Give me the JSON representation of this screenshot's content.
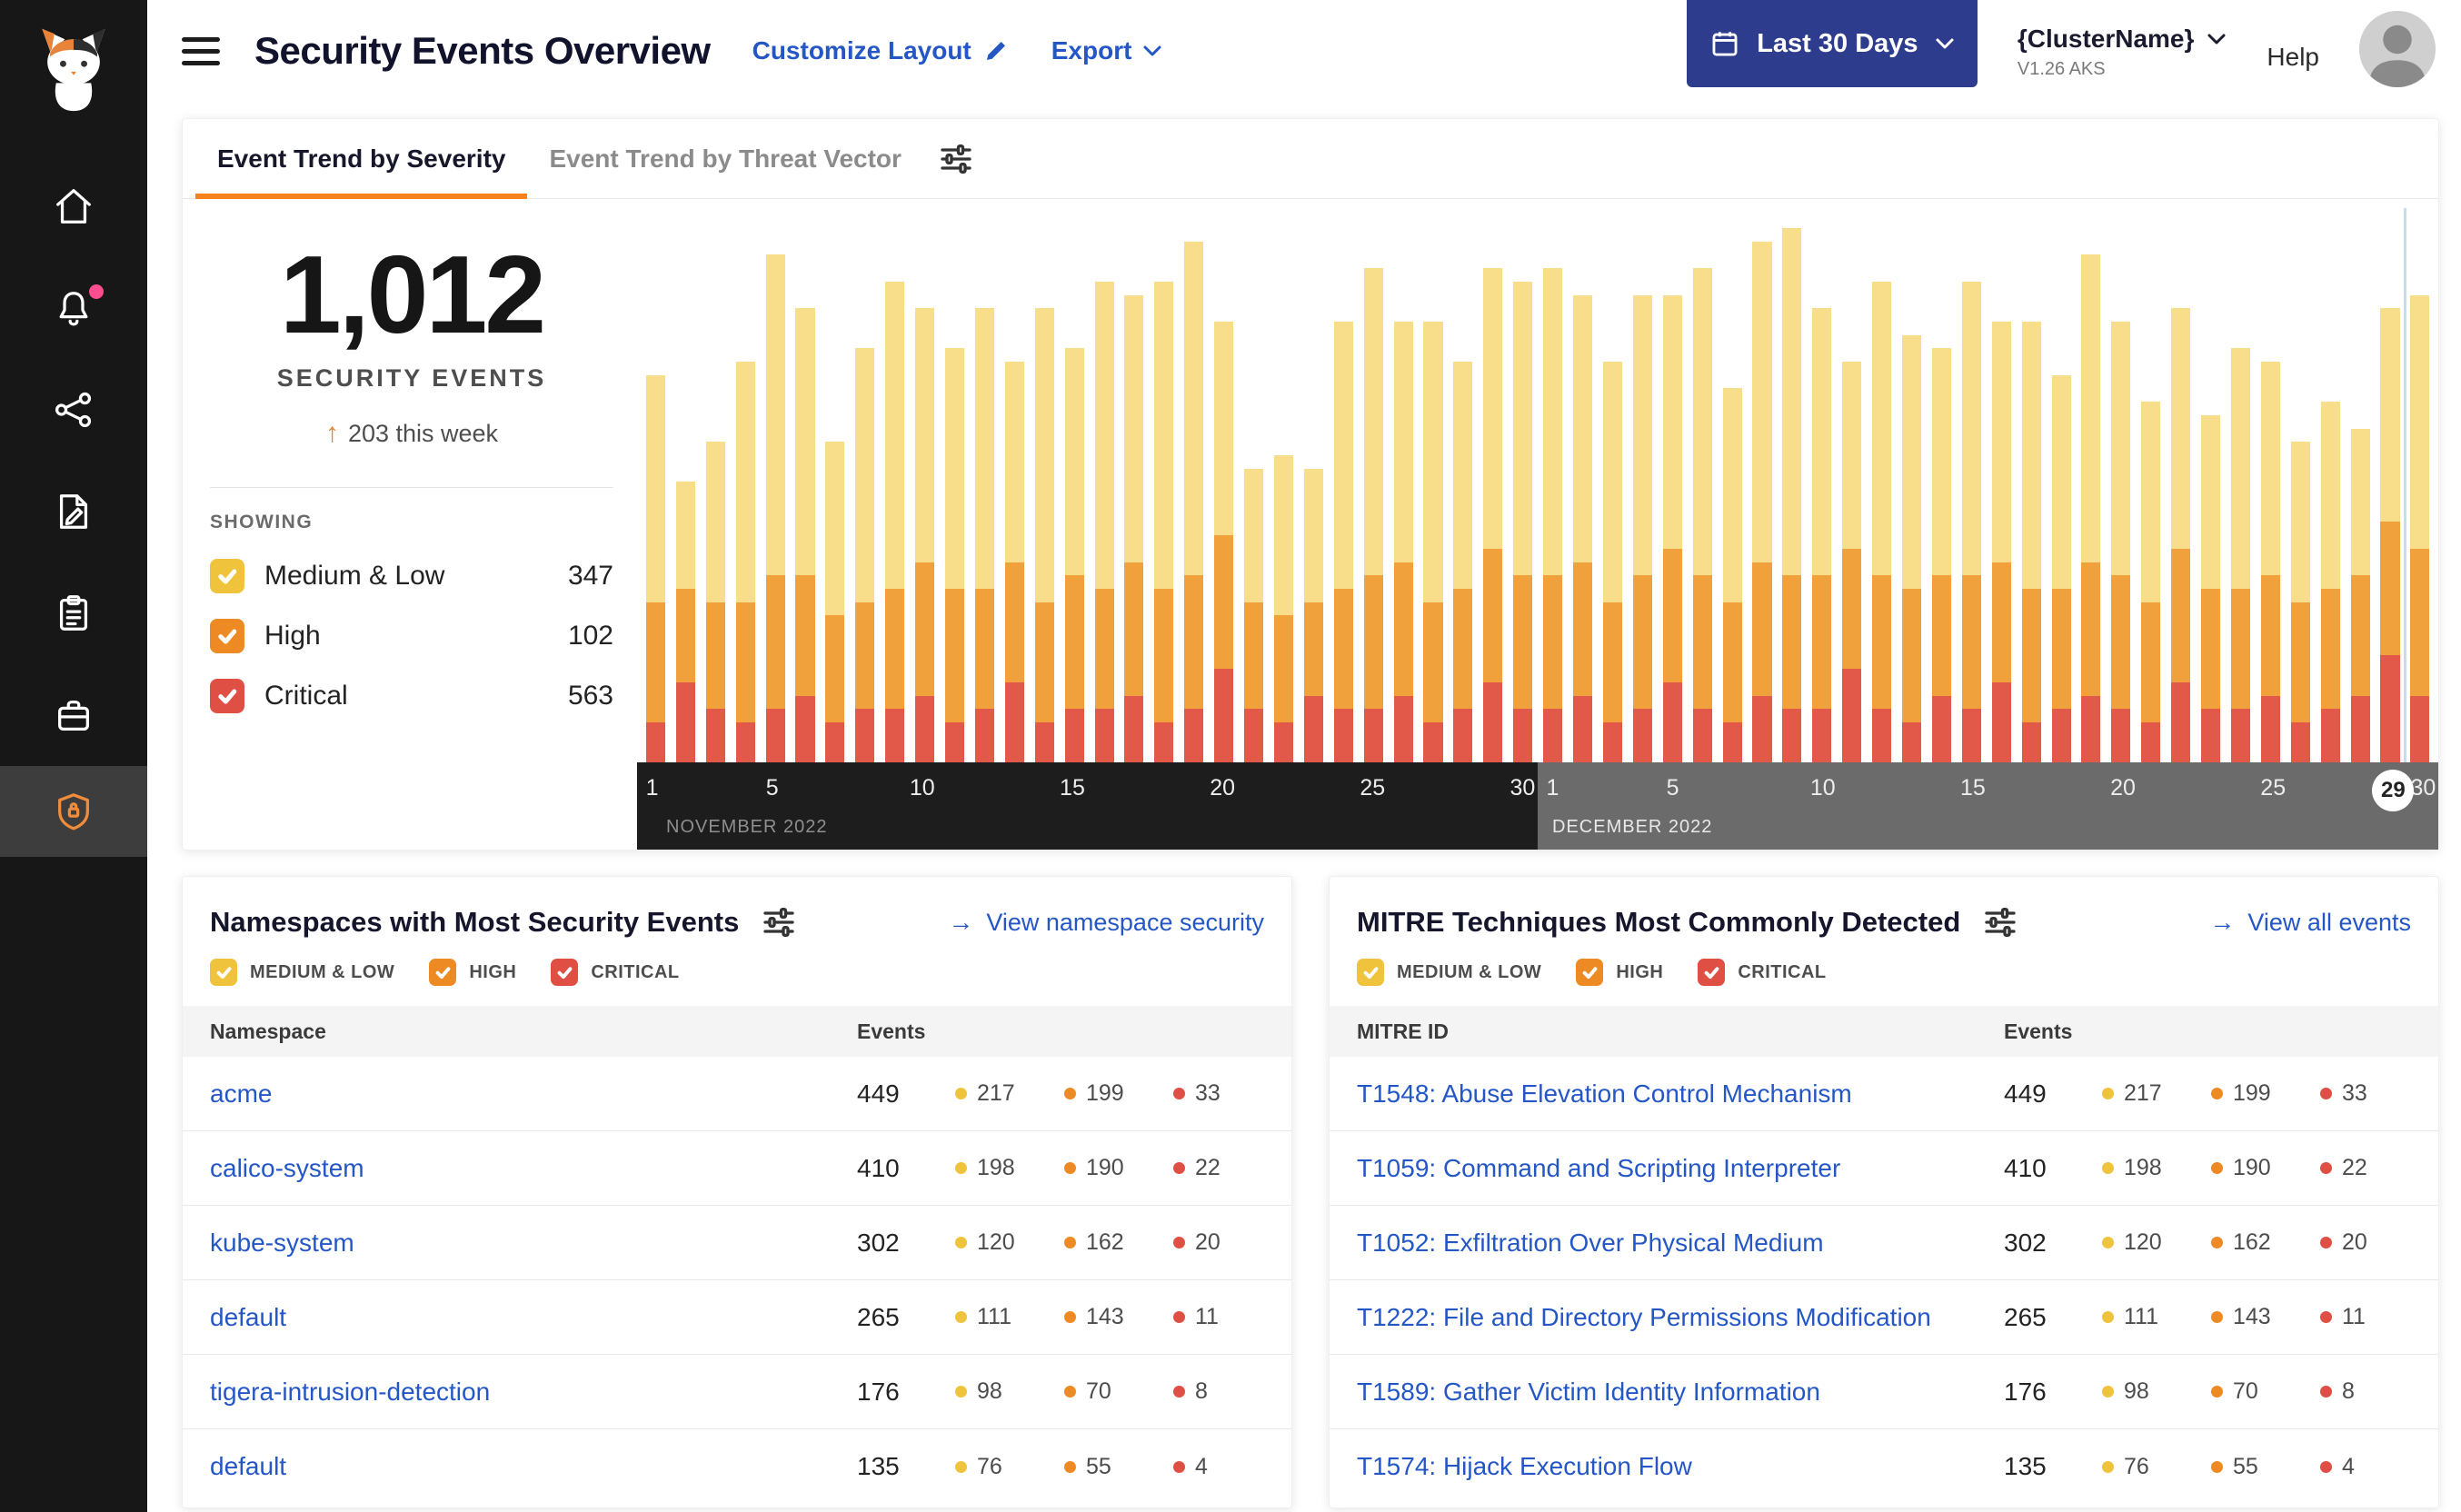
{
  "severity_colors": {
    "medium_low": "#EFC33C",
    "high": "#EE8A24",
    "critical": "#DF4F43"
  },
  "sidebar": {
    "logo": "calico-cat-mascot",
    "items": [
      {
        "name": "home"
      },
      {
        "name": "notifications",
        "badge": true
      },
      {
        "name": "service-graph"
      },
      {
        "name": "policies"
      },
      {
        "name": "compliance-reports"
      },
      {
        "name": "applications"
      },
      {
        "name": "security-events",
        "active": true
      }
    ]
  },
  "header": {
    "title": "Security Events Overview",
    "customize_layout": "Customize Layout",
    "export": "Export",
    "date_range": "Last 30 Days",
    "cluster_name": "{ClusterName}",
    "cluster_version": "V1.26 AKS",
    "help": "Help"
  },
  "trend": {
    "tabs": [
      {
        "label": "Event Trend by Severity",
        "active": true
      },
      {
        "label": "Event Trend by Threat Vector",
        "active": false
      }
    ],
    "total": "1,012",
    "total_caption": "SECURITY EVENTS",
    "delta": "203 this week",
    "showing": "SHOWING",
    "filters": [
      {
        "label": "Medium & Low",
        "count": "347",
        "severity": "medium_low",
        "checked": true
      },
      {
        "label": "High",
        "count": "102",
        "severity": "high",
        "checked": true
      },
      {
        "label": "Critical",
        "count": "563",
        "severity": "critical",
        "checked": true
      }
    ]
  },
  "chart_data": {
    "type": "bar",
    "stacked": true,
    "ylim": [
      0,
      40
    ],
    "unit": "security events per day",
    "months": [
      {
        "label": "NOVEMBER 2022",
        "days": 30
      },
      {
        "label": "DECEMBER 2022",
        "days": 30
      }
    ],
    "tick_days": [
      1,
      5,
      10,
      15,
      20,
      25,
      30
    ],
    "highlight": {
      "month_index": 1,
      "day": 29
    },
    "series": [
      {
        "name": "Medium & Low",
        "color": "#F8DE8A",
        "values": [
          17,
          8,
          12,
          18,
          24,
          20,
          13,
          19,
          23,
          19,
          18,
          21,
          15,
          22,
          17,
          23,
          20,
          23,
          25,
          16,
          10,
          12,
          10,
          20,
          23,
          18,
          21,
          17,
          21,
          22,
          23,
          20,
          18,
          21,
          19,
          23,
          16,
          24,
          26,
          20,
          14,
          22,
          19,
          17,
          22,
          18,
          20,
          16,
          23,
          19,
          15,
          18,
          13,
          18,
          16,
          12,
          14,
          11,
          16,
          19
        ]
      },
      {
        "name": "High",
        "color": "#F1A13C",
        "values": [
          9,
          7,
          8,
          9,
          10,
          9,
          8,
          8,
          9,
          10,
          10,
          9,
          9,
          9,
          10,
          9,
          10,
          10,
          10,
          10,
          8,
          8,
          7,
          9,
          10,
          10,
          9,
          9,
          10,
          10,
          10,
          10,
          9,
          10,
          10,
          10,
          9,
          10,
          10,
          10,
          9,
          10,
          10,
          9,
          10,
          9,
          10,
          9,
          10,
          10,
          9,
          10,
          9,
          9,
          9,
          9,
          9,
          9,
          10,
          11
        ]
      },
      {
        "name": "Critical",
        "color": "#E2594A",
        "values": [
          3,
          6,
          4,
          3,
          4,
          5,
          3,
          4,
          4,
          5,
          3,
          4,
          6,
          3,
          4,
          4,
          5,
          3,
          4,
          7,
          4,
          3,
          5,
          4,
          4,
          5,
          3,
          4,
          6,
          4,
          4,
          5,
          3,
          4,
          6,
          4,
          3,
          5,
          4,
          4,
          7,
          4,
          3,
          5,
          4,
          6,
          3,
          4,
          5,
          4,
          3,
          6,
          4,
          4,
          5,
          3,
          4,
          5,
          8,
          5
        ]
      }
    ]
  },
  "namespaces": {
    "title": "Namespaces with Most Security Events",
    "link": "View namespace security",
    "legend": [
      "MEDIUM & LOW",
      "HIGH",
      "CRITICAL"
    ],
    "col_name": "Namespace",
    "col_events": "Events",
    "rows": [
      {
        "name": "acme",
        "total": "449",
        "medium_low": "217",
        "high": "199",
        "critical": "33"
      },
      {
        "name": "calico-system",
        "total": "410",
        "medium_low": "198",
        "high": "190",
        "critical": "22"
      },
      {
        "name": "kube-system",
        "total": "302",
        "medium_low": "120",
        "high": "162",
        "critical": "20"
      },
      {
        "name": "default",
        "total": "265",
        "medium_low": "111",
        "high": "143",
        "critical": "11"
      },
      {
        "name": "tigera-intrusion-detection",
        "total": "176",
        "medium_low": "98",
        "high": "70",
        "critical": "8"
      },
      {
        "name": "default",
        "total": "135",
        "medium_low": "76",
        "high": "55",
        "critical": "4"
      }
    ]
  },
  "mitre": {
    "title": "MITRE Techniques Most Commonly Detected",
    "link": "View all events",
    "legend": [
      "MEDIUM & LOW",
      "HIGH",
      "CRITICAL"
    ],
    "col_name": "MITRE ID",
    "col_events": "Events",
    "rows": [
      {
        "name": "T1548: Abuse Elevation Control Mechanism",
        "total": "449",
        "medium_low": "217",
        "high": "199",
        "critical": "33"
      },
      {
        "name": "T1059: Command and Scripting Interpreter",
        "total": "410",
        "medium_low": "198",
        "high": "190",
        "critical": "22"
      },
      {
        "name": "T1052: Exfiltration Over Physical Medium",
        "total": "302",
        "medium_low": "120",
        "high": "162",
        "critical": "20"
      },
      {
        "name": "T1222: File and Directory Permissions Modification",
        "total": "265",
        "medium_low": "111",
        "high": "143",
        "critical": "11"
      },
      {
        "name": "T1589: Gather Victim Identity Information",
        "total": "176",
        "medium_low": "98",
        "high": "70",
        "critical": "8"
      },
      {
        "name": "T1574: Hijack Execution Flow",
        "total": "135",
        "medium_low": "76",
        "high": "55",
        "critical": "4"
      }
    ]
  }
}
